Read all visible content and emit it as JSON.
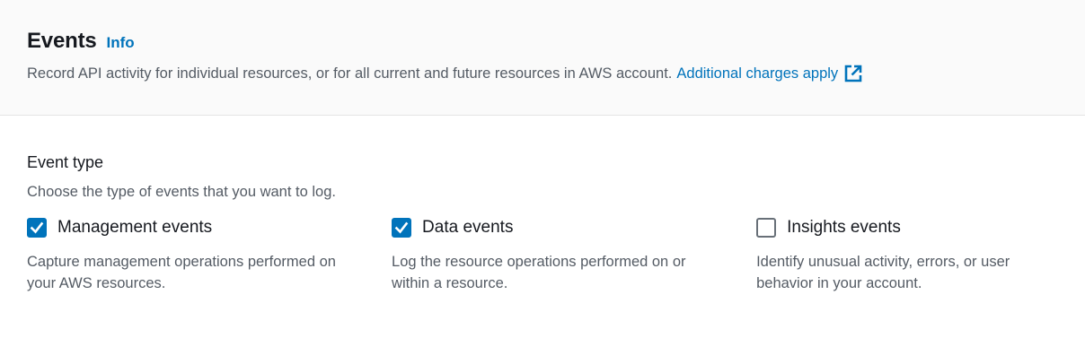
{
  "header": {
    "title": "Events",
    "info_label": "Info",
    "description": "Record API activity for individual resources, or for all current and future resources in AWS account.",
    "charges_link": "Additional charges apply",
    "charges_icon": "external-link-icon"
  },
  "event_type": {
    "label": "Event type",
    "description": "Choose the type of events that you want to log.",
    "options": [
      {
        "label": "Management events",
        "checked": true,
        "description": "Capture management operations performed on your AWS resources."
      },
      {
        "label": "Data events",
        "checked": true,
        "description": "Log the resource operations performed on or within a resource."
      },
      {
        "label": "Insights events",
        "checked": false,
        "description": "Identify unusual activity, errors, or user behavior in your account."
      }
    ]
  },
  "colors": {
    "accent": "#0073bb",
    "text_primary": "#16191f",
    "text_secondary": "#545b64",
    "header_bg": "#fafafa"
  }
}
